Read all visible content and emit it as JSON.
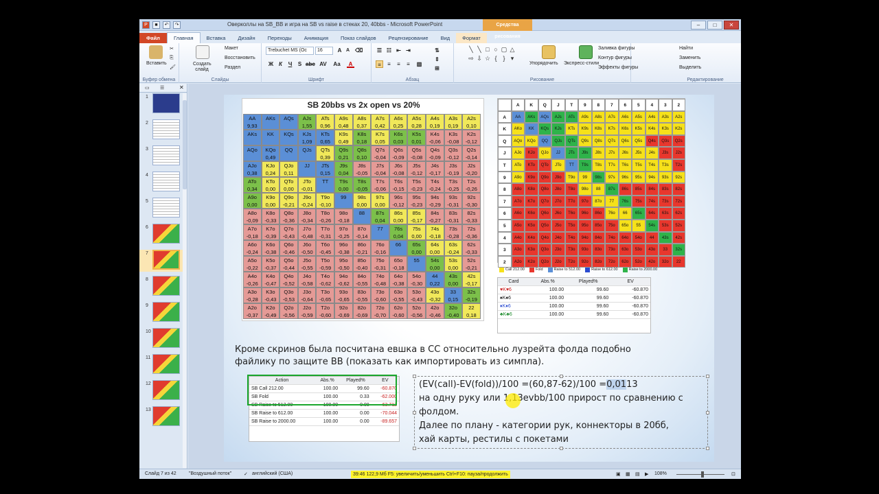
{
  "window": {
    "title": "Оверколлы на SB_BB и игра на SB vs raise в стеках 20, 40bbs - Microsoft PowerPoint",
    "context_tab": "Средства рисования"
  },
  "tabs": [
    "Файл",
    "Главная",
    "Вставка",
    "Дизайн",
    "Переходы",
    "Анимация",
    "Показ слайдов",
    "Рецензирование",
    "Вид",
    "Формат"
  ],
  "ribbon": {
    "paste": "Вставить",
    "clipboard": "Буфер обмена",
    "new_slide": "Создать слайд",
    "layout": "Макет",
    "reset": "Восстановить",
    "section": "Раздел",
    "slides": "Слайды",
    "font_name": "Trebuchet MS (Ос",
    "font_size": "16",
    "font": "Шрифт",
    "paragraph": "Абзац",
    "arrange": "Упорядочить",
    "quick_styles": "Экспресс-стили",
    "fill": "Заливка фигуры",
    "outline": "Контур фигуры",
    "effects": "Эффекты фигуры",
    "drawing": "Рисование",
    "find": "Найти",
    "replace": "Заменить",
    "select": "Выделить",
    "editing": "Редактирование"
  },
  "status": {
    "slide": "Слайд 7 из 42",
    "theme": "\"Воздушный поток\"",
    "lang": "английский (США)",
    "recorder": "39:46  122,9 Мб  F5: увеличить/уменьшить  Ctrl+F10: пауза/продолжить",
    "zoom": "108%"
  },
  "thumbnails": [
    1,
    2,
    3,
    4,
    5,
    6,
    7,
    8,
    9,
    10,
    11,
    12,
    13
  ],
  "selected_slide": 7,
  "chart1": {
    "title": "SB 20bbs vs 2x open vs 20%",
    "hands": [
      [
        "AA",
        "AKs",
        "AQs",
        "AJs",
        "ATs",
        "A9s",
        "A8s",
        "A7s",
        "A6s",
        "A5s",
        "A4s",
        "A3s",
        "A2s"
      ],
      [
        "AKs",
        "KK",
        "KQs",
        "KJs",
        "KTs",
        "K9s",
        "K8s",
        "K7s",
        "K6s",
        "K5s",
        "K4s",
        "K3s",
        "K2s"
      ],
      [
        "AQo",
        "KQo",
        "QQ",
        "QJs",
        "QTs",
        "Q9s",
        "Q8s",
        "Q7s",
        "Q6s",
        "Q5s",
        "Q4s",
        "Q3s",
        "Q2s"
      ],
      [
        "AJo",
        "KJo",
        "QJo",
        "JJ",
        "JTs",
        "J9s",
        "J8s",
        "J7s",
        "J6s",
        "J5s",
        "J4s",
        "J3s",
        "J2s"
      ],
      [
        "ATo",
        "KTo",
        "QTo",
        "JTo",
        "TT",
        "T9s",
        "T8s",
        "T7s",
        "T6s",
        "T5s",
        "T4s",
        "T3s",
        "T2s"
      ],
      [
        "A9o",
        "K9o",
        "Q9o",
        "J9o",
        "T9o",
        "99",
        "98s",
        "97s",
        "96s",
        "95s",
        "94s",
        "93s",
        "92s"
      ],
      [
        "A8o",
        "K8o",
        "Q8o",
        "J8o",
        "T8o",
        "98o",
        "88",
        "87s",
        "86s",
        "85s",
        "84s",
        "83s",
        "82s"
      ],
      [
        "A7o",
        "K7o",
        "Q7o",
        "J7o",
        "T7o",
        "97o",
        "87o",
        "77",
        "76s",
        "75s",
        "74s",
        "73s",
        "72s"
      ],
      [
        "A6o",
        "K6o",
        "Q6o",
        "J6o",
        "T6o",
        "96o",
        "86o",
        "76o",
        "66",
        "65s",
        "64s",
        "63s",
        "62s"
      ],
      [
        "A5o",
        "K5o",
        "Q5o",
        "J5o",
        "T5o",
        "95o",
        "85o",
        "75o",
        "65o",
        "55",
        "54s",
        "53s",
        "52s"
      ],
      [
        "A4o",
        "K4o",
        "Q4o",
        "J4o",
        "T4o",
        "94o",
        "84o",
        "74o",
        "64o",
        "54o",
        "44",
        "43s",
        "42s"
      ],
      [
        "A3o",
        "K3o",
        "Q3o",
        "J3o",
        "T3o",
        "93o",
        "83o",
        "73o",
        "63o",
        "53o",
        "43o",
        "33",
        "32s"
      ],
      [
        "A2o",
        "K2o",
        "Q2o",
        "J2o",
        "T2o",
        "92o",
        "82o",
        "72o",
        "62o",
        "52o",
        "42o",
        "32o",
        "22"
      ]
    ],
    "values": [
      [
        "9,93",
        "",
        "",
        "1,55",
        "0,96",
        "0,48",
        "0,37",
        "0,42",
        "0,25",
        "0,28",
        "0,19",
        "0,19",
        "0,10"
      ],
      [
        "",
        "",
        "",
        "1,09",
        "0,65",
        "0,49",
        "0,18",
        "0,05",
        "0,03",
        "0,01",
        "-0,06",
        "-0,08",
        "-0,12"
      ],
      [
        "",
        "0,49",
        "",
        "",
        "0,39",
        "0,21",
        "0,10",
        "-0,04",
        "-0,09",
        "-0,08",
        "-0,09",
        "-0,12",
        "-0,14"
      ],
      [
        "0,38",
        "0,24",
        "0,11",
        "",
        "0,15",
        "0,04",
        "-0,05",
        "-0,04",
        "-0,08",
        "-0,12",
        "-0,17",
        "-0,19",
        "-0,20"
      ],
      [
        "0,34",
        "0,00",
        "0,00",
        "-0,01",
        "",
        "0,00",
        "-0,05",
        "-0,06",
        "-0,15",
        "-0,23",
        "-0,24",
        "-0,25",
        "-0,26"
      ],
      [
        "0,00",
        "0,00",
        "-0,21",
        "-0,24",
        "-0,10",
        "",
        "0,00",
        "0,00",
        "-0,12",
        "-0,23",
        "-0,29",
        "-0,31",
        "-0,30"
      ],
      [
        "-0,09",
        "-0,33",
        "-0,36",
        "-0,34",
        "-0,26",
        "-0,18",
        "",
        "0,04",
        "0,00",
        "-0,17",
        "-0,27",
        "-0,31",
        "-0,33"
      ],
      [
        "-0,18",
        "-0,39",
        "-0,43",
        "-0,48",
        "-0,31",
        "-0,25",
        "-0,14",
        "",
        "0,04",
        "0,00",
        "-0,18",
        "-0,28",
        "-0,36"
      ],
      [
        "-0,24",
        "-0,38",
        "-0,46",
        "-0,50",
        "-0,45",
        "-0,38",
        "-0,21",
        "-0,16",
        "",
        "0,00",
        "0,00",
        "-0,24",
        "-0,33"
      ],
      [
        "-0,22",
        "-0,37",
        "-0,44",
        "-0,55",
        "-0,59",
        "-0,50",
        "-0,40",
        "-0,31",
        "-0,18",
        "",
        "0,00",
        "0,00",
        "-0,21"
      ],
      [
        "-0,26",
        "-0,47",
        "-0,52",
        "-0,58",
        "-0,62",
        "-0,62",
        "-0,55",
        "-0,48",
        "-0,38",
        "-0,30",
        "0,22",
        "0,00",
        "-0,17"
      ],
      [
        "-0,28",
        "-0,43",
        "-0,53",
        "-0,64",
        "-0,65",
        "-0,65",
        "-0,55",
        "-0,60",
        "-0,55",
        "-0,43",
        "-0,32",
        "0,15",
        "-0,19"
      ],
      [
        "-0,37",
        "-0,49",
        "-0,56",
        "-0,59",
        "-0,60",
        "-0,69",
        "-0,69",
        "-0,70",
        "-0,60",
        "-0,56",
        "-0,46",
        "-0,40",
        "0,18"
      ]
    ]
  },
  "chart2": {
    "ranks": [
      "A",
      "K",
      "Q",
      "J",
      "T",
      "9",
      "8",
      "7",
      "6",
      "5",
      "4",
      "3",
      "2"
    ],
    "legend": [
      "Call 212.00",
      "Fold",
      "Raise to 512.00",
      "Raise to 612.00",
      "Raise to 2000.00"
    ]
  },
  "card_table": {
    "headers": [
      "Card",
      "Abs.%",
      "Played%",
      "EV"
    ],
    "rows": [
      {
        "card": "♥K♥6",
        "abs": "100.00",
        "played": "99.60",
        "ev": "-60.870"
      },
      {
        "card": "♠K♠6",
        "abs": "100.00",
        "played": "99.60",
        "ev": "-60.870"
      },
      {
        "card": "♦K♦6",
        "abs": "100.00",
        "played": "99.60",
        "ev": "-60.870"
      },
      {
        "card": "♣K♣6",
        "abs": "100.00",
        "played": "99.60",
        "ev": "-60.870"
      }
    ]
  },
  "action_table": {
    "headers": [
      "Action",
      "Abs.%",
      "Played%",
      "EV"
    ],
    "rows": [
      {
        "action": "SB Call 212.00",
        "abs": "100.00",
        "played": "99.60",
        "ev": "-60.870"
      },
      {
        "action": "SB Fold",
        "abs": "100.00",
        "played": "0.33",
        "ev": "-62.000"
      },
      {
        "action": "SB Raise to 512.00",
        "abs": "100.00",
        "played": "0.08",
        "ev": "-63.712"
      },
      {
        "action": "SB Raise to 612.00",
        "abs": "100.00",
        "played": "0.00",
        "ev": "-70.044"
      },
      {
        "action": "SB Raise to 2000.00",
        "abs": "100.00",
        "played": "0.00",
        "ev": "-89.657"
      }
    ]
  },
  "body_text": {
    "line1": "Кроме скринов была посчитана евшка в СС относительно лузрейта фолда подобно",
    "line2": "файлику по защите ВВ (показать как импортировать из симпла).",
    "b1": "(EV(call)-EV(fold))/100 =(60,87-62)/100 =",
    "b1h": "0,01",
    "b1e": "13",
    "b2": "на одну руку или 1,13evbb/100 прирост по сравнению с",
    "b3": "фолдом.",
    "b4": "Далее по плану - категории рук, коннекторы в 20бб,",
    "b5": "хай карты, рестилы с покетами"
  }
}
